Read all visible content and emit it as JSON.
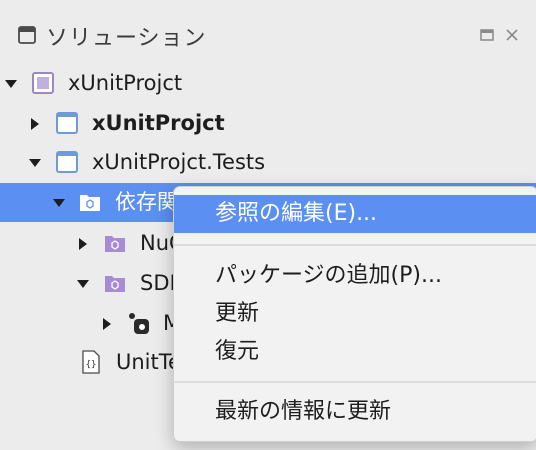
{
  "pad": {
    "title": "ソリューション",
    "header_icon": "solution-pad-icon",
    "controls": [
      "maximize-icon",
      "close-icon"
    ]
  },
  "tree": {
    "rows": [
      {
        "label": "xUnitProjct",
        "icon": "solution-icon",
        "expanded": true,
        "bold": false
      },
      {
        "label": "xUnitProjct",
        "icon": "project-icon",
        "expanded": false,
        "bold": true
      },
      {
        "label": "xUnitProjct.Tests",
        "icon": "project-icon",
        "expanded": true,
        "bold": false
      },
      {
        "label": "依存関",
        "icon": "folder-icon",
        "expanded": true,
        "bold": false,
        "selected": true
      },
      {
        "label": "NuG",
        "icon": "folder-icon",
        "expanded": false,
        "bold": false
      },
      {
        "label": "SDK",
        "icon": "folder-icon",
        "expanded": true,
        "bold": false
      },
      {
        "label": "M",
        "icon": "package-icon",
        "expanded": false,
        "bold": false
      },
      {
        "label": "UnitTe",
        "icon": "code-file-icon",
        "expanded": null,
        "bold": false
      }
    ]
  },
  "context_menu": {
    "items": [
      {
        "label": "参照の編集(E)...",
        "highlighted": true
      },
      {
        "label": "パッケージの追加(P)..."
      },
      {
        "label": "更新"
      },
      {
        "label": "復元"
      },
      {
        "label": "最新の情報に更新"
      }
    ]
  },
  "colors": {
    "selection": "#5b8ff2",
    "background": "#ececec",
    "folder_purple": "#a78bd6",
    "project_blue": "#5a8fd6"
  }
}
